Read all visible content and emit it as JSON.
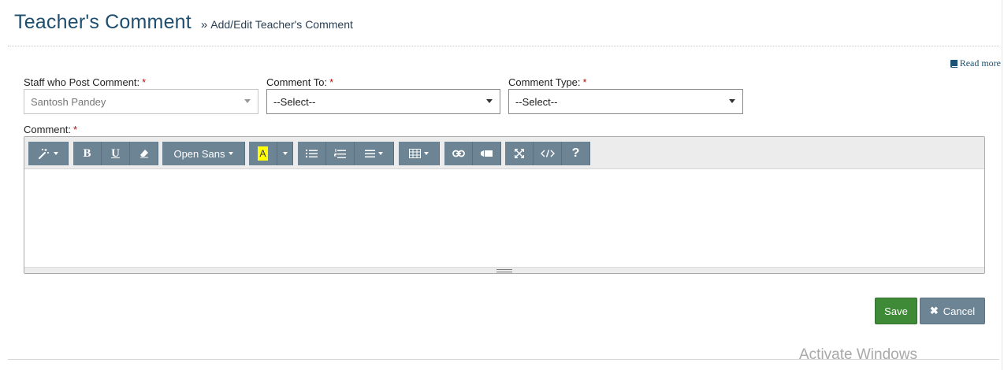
{
  "header": {
    "title": "Teacher's Comment",
    "breadcrumb_separator": "»",
    "breadcrumb": "Add/Edit Teacher's Comment"
  },
  "read_more": {
    "label": "Read more",
    "icon": "book-icon"
  },
  "form": {
    "required_marker": "*",
    "staff": {
      "label": "Staff who Post Comment:",
      "value": "Santosh Pandey"
    },
    "comment_to": {
      "label": "Comment To:",
      "value": "--Select--"
    },
    "comment_type": {
      "label": "Comment Type:",
      "value": "--Select--"
    },
    "comment": {
      "label": "Comment:"
    }
  },
  "toolbar": {
    "font_name": "Open Sans",
    "bold": "B",
    "underline": "U",
    "highlight": "A",
    "help": "?",
    "icons": [
      "magic-icon",
      "eraser-icon",
      "bullet-list-icon",
      "numbered-list-icon",
      "align-icon",
      "table-icon",
      "link-icon",
      "video-icon",
      "fullscreen-icon",
      "code-view-icon"
    ],
    "highlight_color": "#ffff00"
  },
  "buttons": {
    "save": "Save",
    "cancel": "Cancel"
  },
  "watermark": "Activate Windows",
  "colors": {
    "title": "#1f4e6e",
    "toolbar_button": "#6d8494",
    "save": "#3e8a37",
    "cancel": "#6d8494",
    "required": "#b01010"
  }
}
